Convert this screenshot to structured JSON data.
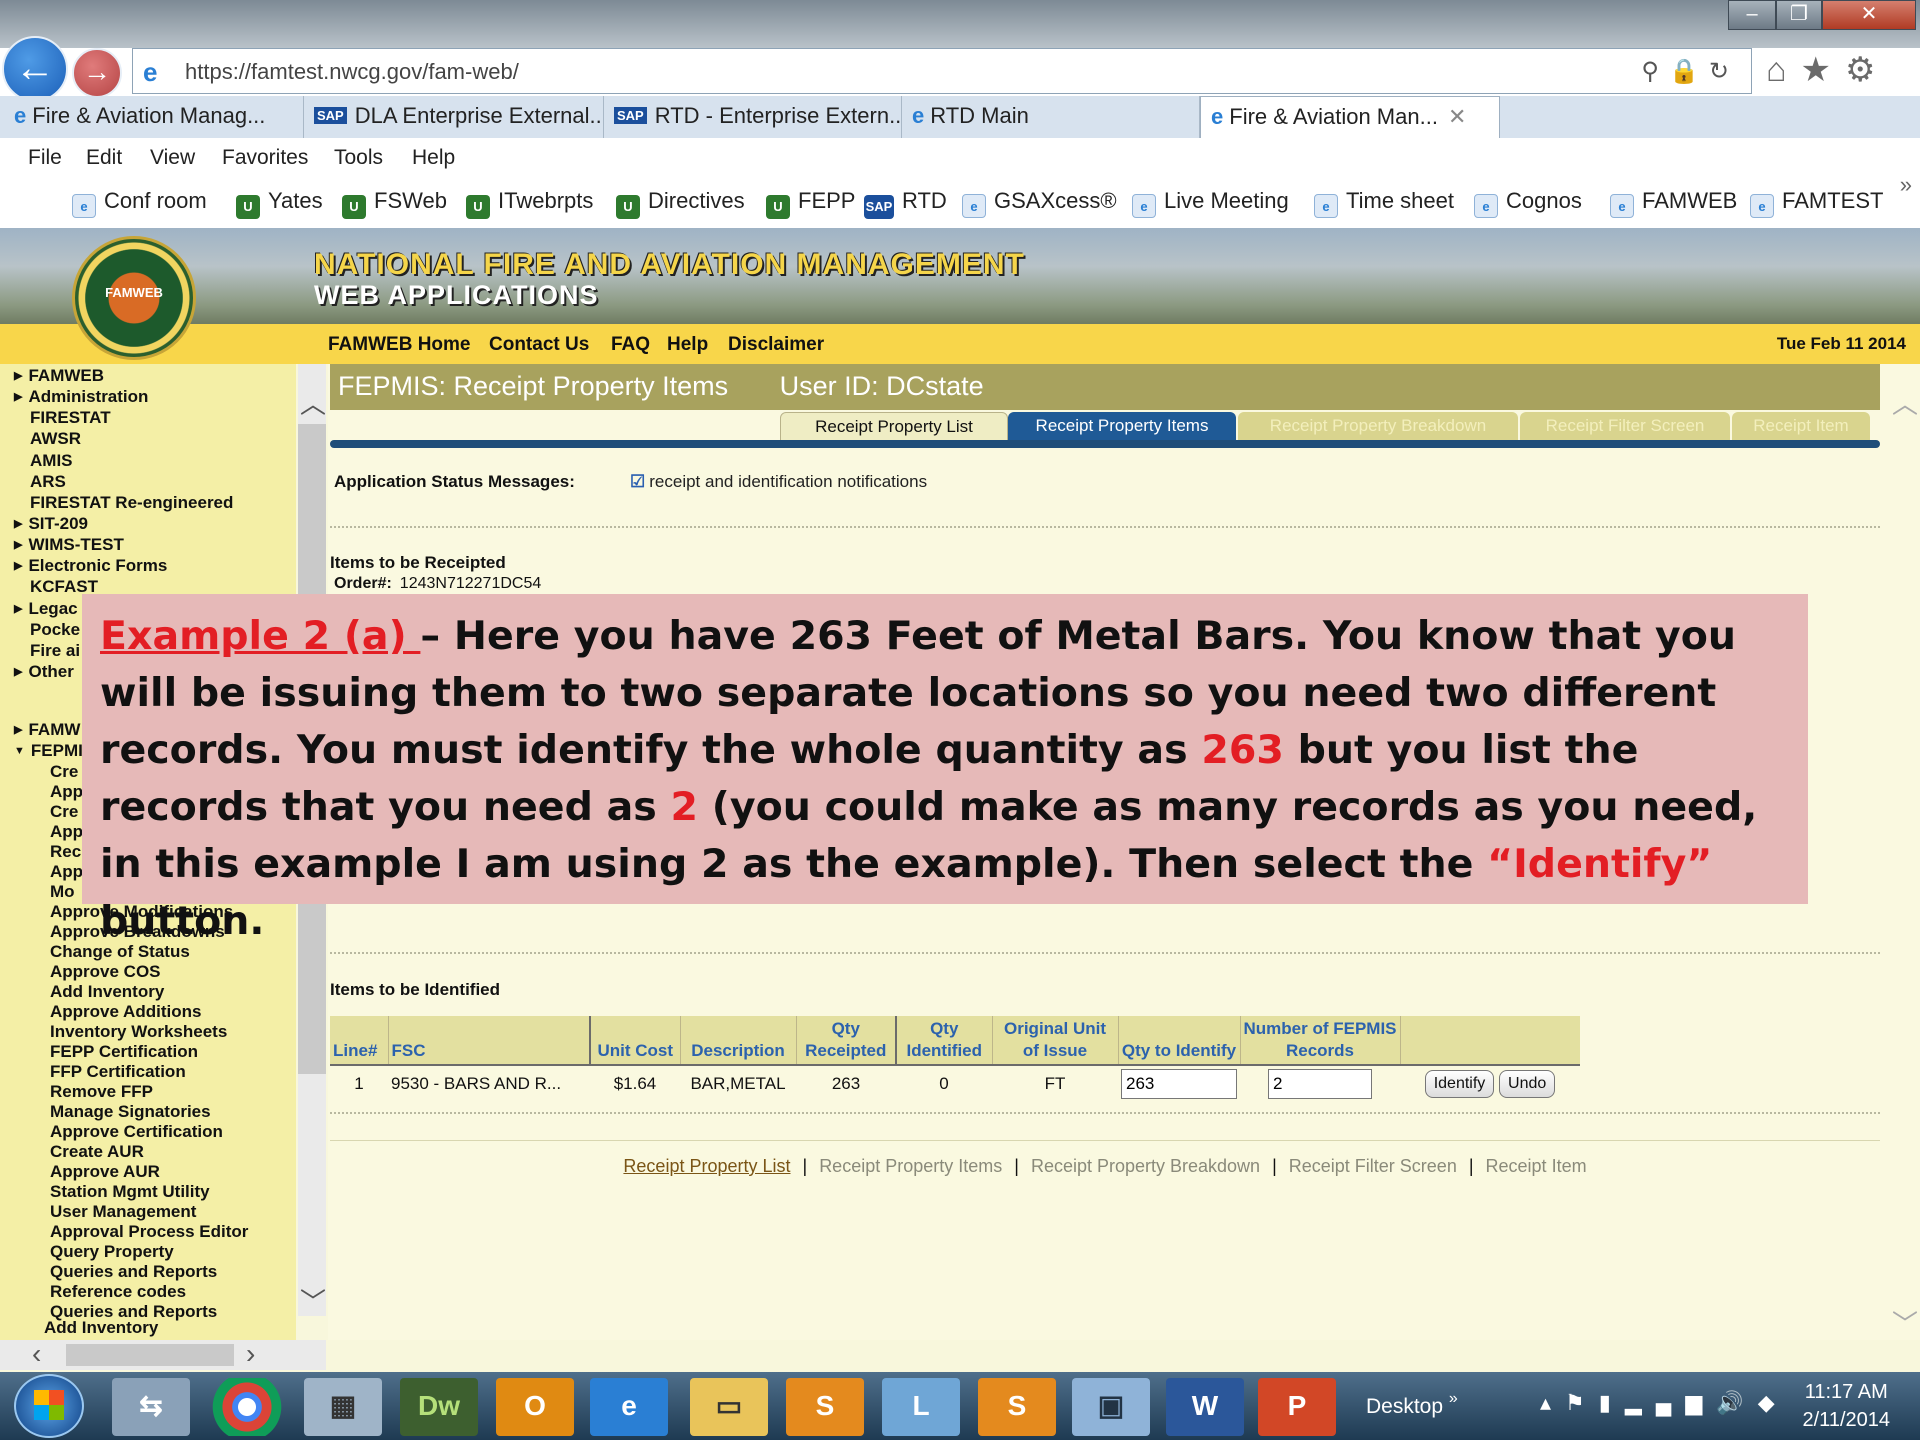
{
  "browser": {
    "url": "https://famtest.nwcg.gov/fam-web/",
    "tabs": [
      {
        "label": "Fire & Aviation Manag...",
        "icon": "ie-icon"
      },
      {
        "label": "DLA Enterprise External...",
        "icon": "sap-icon"
      },
      {
        "label": "RTD - Enterprise Extern...",
        "icon": "sap-icon"
      },
      {
        "label": "RTD Main",
        "icon": "ie-icon"
      },
      {
        "label": "Fire & Aviation Man...",
        "icon": "ie-icon",
        "active": true
      }
    ],
    "menu": [
      "File",
      "Edit",
      "View",
      "Favorites",
      "Tools",
      "Help"
    ],
    "favorites": [
      "Conf room",
      "Yates",
      "FSWeb",
      "ITwebrpts",
      "Directives",
      "FEPP",
      "RTD",
      "GSAXcess®",
      "Live Meeting",
      "Time sheet",
      "Cognos",
      "FAMWEB",
      "FAMTEST"
    ],
    "sap_badge": "SAP"
  },
  "site": {
    "title_line1": "NATIONAL FIRE AND AVIATION MANAGEMENT",
    "title_line2": "WEB APPLICATIONS",
    "logo_text": "FAMWEB",
    "nav": [
      "FAMWEB Home",
      "Contact Us",
      "FAQ",
      "Help",
      "Disclaimer"
    ],
    "date": "Tue Feb 11 2014"
  },
  "sidebar": {
    "items": [
      "FAMWEB",
      "Administration",
      "FIRESTAT",
      "AWSR",
      "AMIS",
      "ARS",
      "FIRESTAT Re-engineered",
      "SIT-209",
      "WIMS-TEST",
      "Electronic Forms",
      "KCFAST",
      "Legac",
      "Pocke",
      "Fire ai",
      "Other",
      "FAMW",
      "FEPMI",
      "Cre",
      "App",
      "Cre",
      "App",
      "Rec",
      "App",
      "Mo",
      "Approve Modifications",
      "Approve Breakdowns",
      "Change of Status",
      "Approve COS",
      "Add Inventory",
      "Approve Additions",
      "Inventory Worksheets",
      "FEPP Certification",
      "FFP Certification",
      "Remove FFP",
      "Manage Signatories",
      "Approve Certification",
      "Create AUR",
      "Approve AUR",
      "Station Mgmt Utility",
      "User Management",
      "Approval Process Editor",
      "Query Property",
      "Queries and Reports",
      "Reference codes",
      "Queries and Reports",
      "Add Inventory"
    ]
  },
  "page": {
    "title": "FEPMIS: Receipt Property Items",
    "user": "User ID: DCstate",
    "tabs": [
      "Receipt Property List",
      "Receipt Property Items",
      "Receipt Property Breakdown",
      "Receipt Filter Screen",
      "Receipt Item"
    ],
    "status_label": "Application Status Messages:",
    "status_value": "receipt and identification notifications",
    "recv_title": "Items to be Receipted",
    "order_label": "Order#:",
    "order_value": "1243N712271DC54",
    "ident_title": "Items to be Identified",
    "columns": [
      "Line#",
      "FSC",
      "Unit Cost",
      "Description",
      "Qty Receipted",
      "Qty Identified",
      "Original Unit of Issue",
      "Qty to Identify",
      "Number of FEPMIS Records"
    ],
    "row": {
      "line": "1",
      "fsc": "9530 - BARS AND R...",
      "unit_cost": "$1.64",
      "description": "BAR,METAL",
      "qty_receipted": "263",
      "qty_identified": "0",
      "unit": "FT",
      "qty_to_identify": "263",
      "records": "2"
    },
    "identify_label": "Identify",
    "undo_label": "Undo",
    "bottom_links": [
      "Receipt Property List",
      "Receipt Property Items",
      "Receipt Property Breakdown",
      "Receipt Filter Screen",
      "Receipt Item"
    ]
  },
  "callout": {
    "prefix": "Example 2 (a) ",
    "t1": "– Here you have 263 Feet of Metal Bars.  You know that you will be issuing them to two separate locations so you need two different records.  You must identify the whole quantity  as ",
    "n1": "263",
    "t2": " but you list the records that you need as ",
    "n2": "2",
    "t3": " (you could make as many records as you need, in this example I am using 2 as the example).  Then select the ",
    "quote": "“Identify”",
    "t4": " button."
  },
  "taskbar": {
    "desktop_label": "Desktop",
    "time": "11:17 AM",
    "date": "2/11/2014",
    "apps": [
      "switch-windows",
      "chrome",
      "calculator",
      "Dw",
      "outlook",
      "internet-explorer",
      "file-explorer",
      "snagit",
      "lync",
      "snagit-editor",
      "remote-desktop",
      "W",
      "P"
    ]
  },
  "colors": {
    "accent_red": "#e31e24",
    "callout_bg": "#e6b9b8",
    "header_olive": "#a8a25e",
    "nav_yellow": "#f8d64a"
  }
}
